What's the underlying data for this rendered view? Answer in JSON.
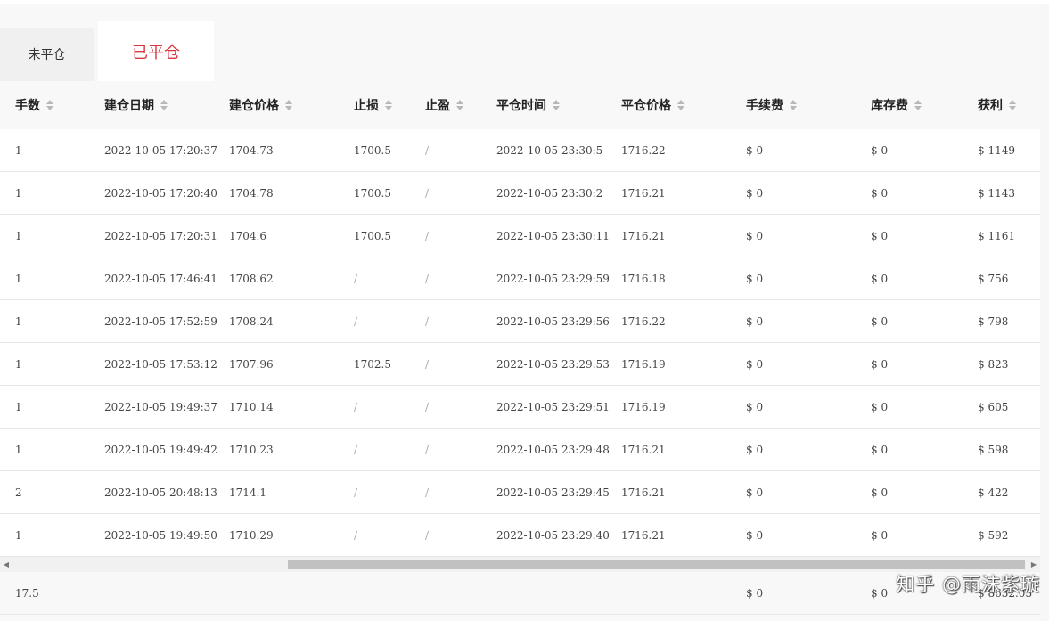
{
  "tabs": [
    {
      "label": "未平仓",
      "active": false
    },
    {
      "label": "已平仓",
      "active": true
    }
  ],
  "columns": [
    "手数",
    "建仓日期",
    "建仓价格",
    "止损",
    "止盈",
    "平仓时间",
    "平仓价格",
    "手续费",
    "库存费",
    "获利"
  ],
  "rows": [
    [
      "1",
      "2022-10-05 17:20:37",
      "1704.73",
      "1700.5",
      "/",
      "2022-10-05 23:30:5",
      "1716.22",
      "$ 0",
      "$ 0",
      "$ 1149"
    ],
    [
      "1",
      "2022-10-05 17:20:40",
      "1704.78",
      "1700.5",
      "/",
      "2022-10-05 23:30:2",
      "1716.21",
      "$ 0",
      "$ 0",
      "$ 1143"
    ],
    [
      "1",
      "2022-10-05 17:20:31",
      "1704.6",
      "1700.5",
      "/",
      "2022-10-05 23:30:11",
      "1716.21",
      "$ 0",
      "$ 0",
      "$ 1161"
    ],
    [
      "1",
      "2022-10-05 17:46:41",
      "1708.62",
      "/",
      "/",
      "2022-10-05 23:29:59",
      "1716.18",
      "$ 0",
      "$ 0",
      "$ 756"
    ],
    [
      "1",
      "2022-10-05 17:52:59",
      "1708.24",
      "/",
      "/",
      "2022-10-05 23:29:56",
      "1716.22",
      "$ 0",
      "$ 0",
      "$ 798"
    ],
    [
      "1",
      "2022-10-05 17:53:12",
      "1707.96",
      "1702.5",
      "/",
      "2022-10-05 23:29:53",
      "1716.19",
      "$ 0",
      "$ 0",
      "$ 823"
    ],
    [
      "1",
      "2022-10-05 19:49:37",
      "1710.14",
      "/",
      "/",
      "2022-10-05 23:29:51",
      "1716.19",
      "$ 0",
      "$ 0",
      "$ 605"
    ],
    [
      "1",
      "2022-10-05 19:49:42",
      "1710.23",
      "/",
      "/",
      "2022-10-05 23:29:48",
      "1716.21",
      "$ 0",
      "$ 0",
      "$ 598"
    ],
    [
      "2",
      "2022-10-05 20:48:13",
      "1714.1",
      "/",
      "/",
      "2022-10-05 23:29:45",
      "1716.21",
      "$ 0",
      "$ 0",
      "$ 422"
    ],
    [
      "1",
      "2022-10-05 19:49:50",
      "1710.29",
      "/",
      "/",
      "2022-10-05 23:29:40",
      "1716.21",
      "$ 0",
      "$ 0",
      "$ 592"
    ]
  ],
  "totals": {
    "lots": "17.5",
    "commission": "$ 0",
    "swap": "$ 0",
    "profit": "$ 8632.03"
  },
  "watermark": "知乎 @雨沫紫璇",
  "colors": {
    "active_tab": "#d9363e",
    "scroll_thumb": "#c1c1c1"
  }
}
